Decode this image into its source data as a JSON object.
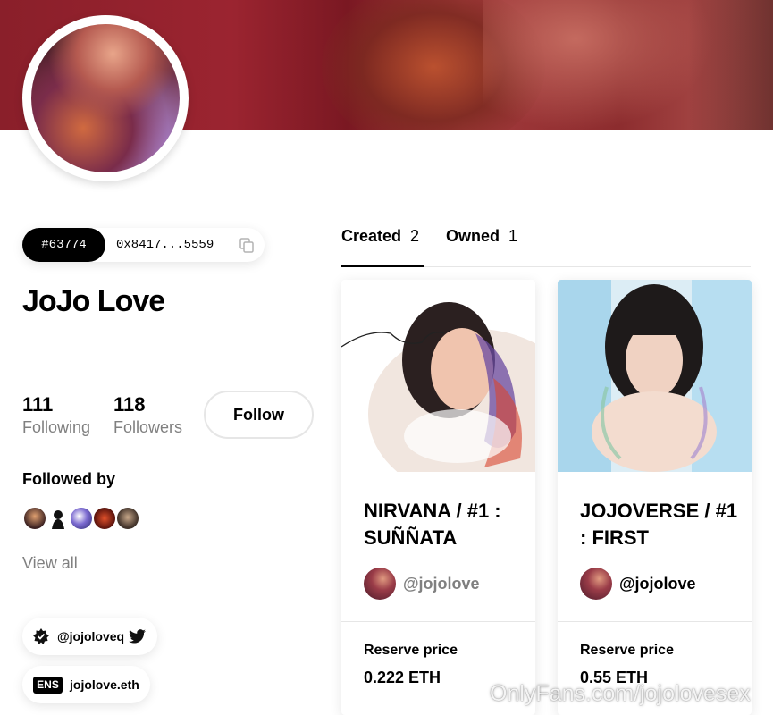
{
  "profile": {
    "id_badge": "#63774",
    "address": "0x8417...5559",
    "name": "JoJo Love",
    "following_count": "111",
    "following_label": "Following",
    "followers_count": "118",
    "followers_label": "Followers",
    "follow_button": "Follow",
    "followed_by_label": "Followed by",
    "view_all_label": "View all",
    "twitter_handle": "@jojoloveq",
    "ens_badge": "ENS",
    "ens_name": "jojolove.eth"
  },
  "tabs": [
    {
      "label": "Created",
      "count": "2",
      "active": true
    },
    {
      "label": "Owned",
      "count": "1",
      "active": false
    }
  ],
  "cards": [
    {
      "title": "NIRVANA / #1 : SUÑÑATA",
      "creator": "@jojolove",
      "reserve_label": "Reserve price",
      "reserve_value": "0.222 ETH"
    },
    {
      "title": "JOJOVERSE / #1 : FIRST",
      "creator": "@jojolove",
      "reserve_label": "Reserve price",
      "reserve_value": "0.55 ETH"
    }
  ],
  "watermark": "OnlyFans.com/jojolovesex",
  "colors": {
    "accent": "#000000",
    "muted": "#808080",
    "cover": "#8a1f2a"
  }
}
